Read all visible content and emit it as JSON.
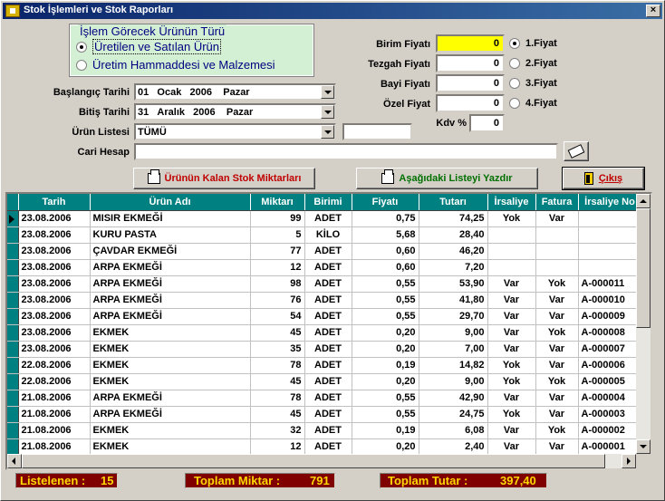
{
  "window": {
    "title": "Stok İşlemleri ve Stok Raporları",
    "close_label": "×"
  },
  "islem_group": {
    "legend": "İşlem Görecek Ürünün Türü",
    "option1": "Üretilen ve Satılan Ürün",
    "option2": "Üretim Hammaddesi ve Malzemesi",
    "selected": 1
  },
  "form": {
    "baslangic_label": "Başlangıç Tarihi",
    "baslangic_day": "01",
    "baslangic_month": "Ocak",
    "baslangic_year": "2006",
    "baslangic_weekday": "Pazar",
    "bitis_label": "Bitiş Tarihi",
    "bitis_day": "31",
    "bitis_month": "Aralık",
    "bitis_year": "2006",
    "bitis_weekday": "Pazar",
    "urun_label": "Ürün Listesi",
    "urun_value": "TÜMÜ",
    "cari_label": "Cari Hesap",
    "cari_value": ""
  },
  "prices": {
    "birim_label": "Birim Fiyatı",
    "birim_value": "0",
    "tezgah_label": "Tezgah Fiyatı",
    "tezgah_value": "0",
    "bayi_label": "Bayi Fiyatı",
    "bayi_value": "0",
    "ozel_label": "Özel Fiyat",
    "ozel_value": "0",
    "kdv_label": "Kdv %",
    "kdv_value": "0",
    "fiyat1": "1.Fiyat",
    "fiyat2": "2.Fiyat",
    "fiyat3": "3.Fiyat",
    "fiyat4": "4.Fiyat",
    "selected": 1
  },
  "buttons": {
    "kalan_stok": "Ürünün Kalan Stok Miktarları",
    "liste_yazdir": "Aşağıdaki Listeyi Yazdır",
    "cikis": "Çıkış"
  },
  "table": {
    "columns": [
      "Tarih",
      "Ürün Adı",
      "Miktarı",
      "Birimi",
      "Fiyatı",
      "Tutarı",
      "İrsaliye",
      "Fatura",
      "İrsaliye No"
    ],
    "rows": [
      [
        "23.08.2006",
        "MISIR EKMEĞİ",
        "99",
        "ADET",
        "0,75",
        "74,25",
        "Yok",
        "Var",
        ""
      ],
      [
        "23.08.2006",
        "KURU PASTA",
        "5",
        "KİLO",
        "5,68",
        "28,40",
        "",
        "",
        ""
      ],
      [
        "23.08.2006",
        "ÇAVDAR EKMEĞİ",
        "77",
        "ADET",
        "0,60",
        "46,20",
        "",
        "",
        ""
      ],
      [
        "23.08.2006",
        "ARPA EKMEĞİ",
        "12",
        "ADET",
        "0,60",
        "7,20",
        "",
        "",
        ""
      ],
      [
        "23.08.2006",
        "ARPA EKMEĞİ",
        "98",
        "ADET",
        "0,55",
        "53,90",
        "Var",
        "Yok",
        "A-000011"
      ],
      [
        "23.08.2006",
        "ARPA EKMEĞİ",
        "76",
        "ADET",
        "0,55",
        "41,80",
        "Var",
        "Var",
        "A-000010"
      ],
      [
        "23.08.2006",
        "ARPA EKMEĞİ",
        "54",
        "ADET",
        "0,55",
        "29,70",
        "Var",
        "Var",
        "A-000009"
      ],
      [
        "23.08.2006",
        "EKMEK",
        "45",
        "ADET",
        "0,20",
        "9,00",
        "Var",
        "Yok",
        "A-000008"
      ],
      [
        "23.08.2006",
        "EKMEK",
        "35",
        "ADET",
        "0,20",
        "7,00",
        "Var",
        "Var",
        "A-000007"
      ],
      [
        "22.08.2006",
        "EKMEK",
        "78",
        "ADET",
        "0,19",
        "14,82",
        "Yok",
        "Var",
        "A-000006"
      ],
      [
        "22.08.2006",
        "EKMEK",
        "45",
        "ADET",
        "0,20",
        "9,00",
        "Yok",
        "Yok",
        "A-000005"
      ],
      [
        "21.08.2006",
        "ARPA EKMEĞİ",
        "78",
        "ADET",
        "0,55",
        "42,90",
        "Var",
        "Var",
        "A-000004"
      ],
      [
        "21.08.2006",
        "ARPA EKMEĞİ",
        "45",
        "ADET",
        "0,55",
        "24,75",
        "Yok",
        "Var",
        "A-000003"
      ],
      [
        "21.08.2006",
        "EKMEK",
        "32",
        "ADET",
        "0,19",
        "6,08",
        "Var",
        "Yok",
        "A-000002"
      ],
      [
        "21.08.2006",
        "EKMEK",
        "12",
        "ADET",
        "0,20",
        "2,40",
        "Var",
        "Var",
        "A-000001"
      ]
    ]
  },
  "status": {
    "listelenen_label": "Listelenen :",
    "listelenen_value": "15",
    "miktar_label": "Toplam Miktar :",
    "miktar_value": "791",
    "tutar_label": "Toplam Tutar :",
    "tutar_value": "397,40"
  }
}
